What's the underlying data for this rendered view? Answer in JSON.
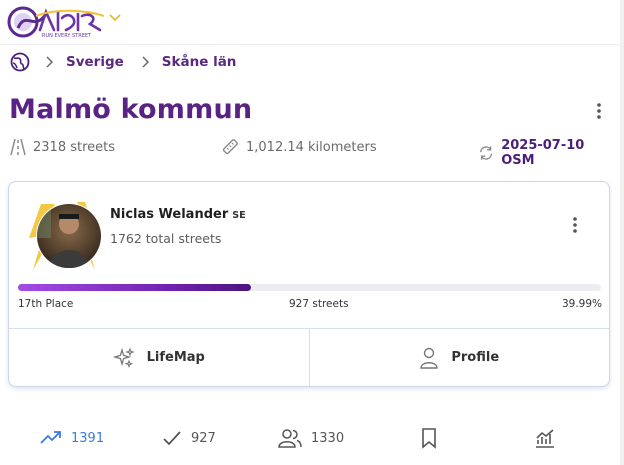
{
  "header": {
    "logo_text": "CityStrides",
    "logo_tagline": "RUN EVERY STREET",
    "logo_menu_icon": "chevron-down-icon"
  },
  "breadcrumb": {
    "home_icon": "globe-icon",
    "items": [
      "Sverige",
      "Skåne län"
    ]
  },
  "page": {
    "title": "Malmö kommun",
    "menu_icon": "more-vertical-icon"
  },
  "stats": {
    "streets": "2318 streets",
    "distance": "1,012.14 kilometers",
    "osm_date": "2025-07-10 OSM"
  },
  "leader_card": {
    "name": "Niclas Welander",
    "country": "SE",
    "total_streets": "1762 total streets",
    "place": "17th Place",
    "streets_completed": "927 streets",
    "percent": "39.99%",
    "progress_fraction": 0.3999,
    "actions": {
      "lifemap": "LifeMap",
      "profile": "Profile"
    }
  },
  "bottom_bar": {
    "trending": "1391",
    "completed": "927",
    "users": "1330"
  },
  "colors": {
    "brand_purple": "#5a2383",
    "progress": "#6c1fa8",
    "active_blue": "#3b7bdc",
    "card_border": "#c9d8ee"
  }
}
